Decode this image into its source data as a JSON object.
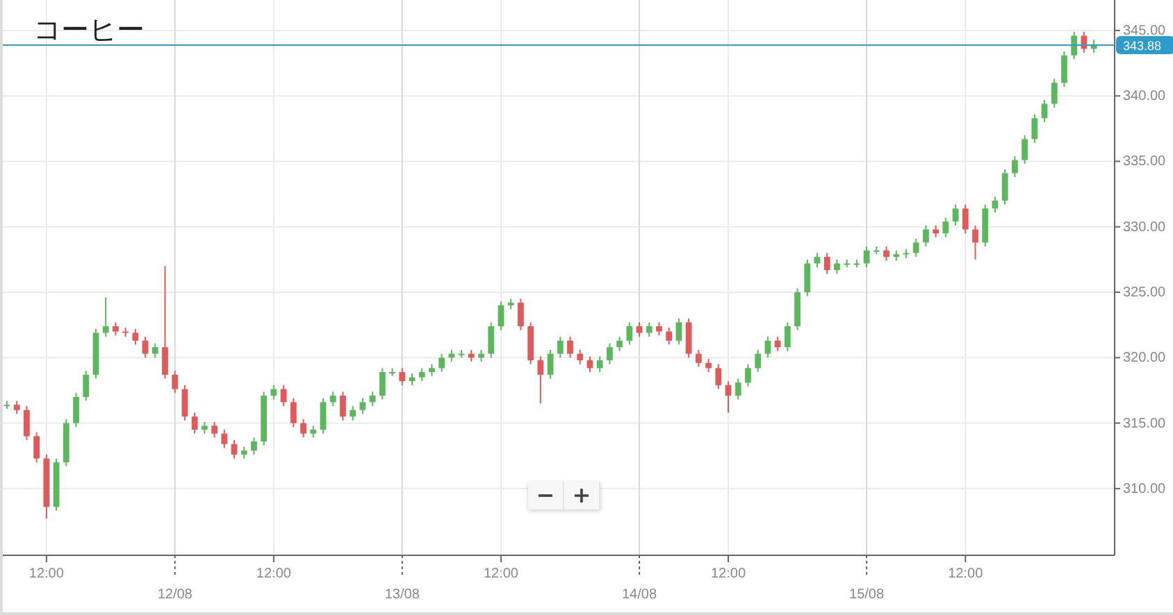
{
  "chart": {
    "chart_data": {
      "type": "candlestick",
      "title": "コーヒー",
      "grid": true,
      "ylim": [
        304.9,
        347.33
      ],
      "yticks": [
        {
          "value": 310,
          "label": "310.00"
        },
        {
          "value": 315,
          "label": "315.00"
        },
        {
          "value": 320,
          "label": "320.00"
        },
        {
          "value": 325,
          "label": "325.00"
        },
        {
          "value": 330,
          "label": "330.00"
        },
        {
          "value": 335,
          "label": "335.00"
        },
        {
          "value": 340,
          "label": "340.00"
        },
        {
          "value": 345,
          "label": "345.00"
        }
      ],
      "categories": [
        null,
        null,
        null,
        null,
        "12:00",
        null,
        null,
        null,
        null,
        null,
        null,
        null,
        null,
        null,
        null,
        null,
        null,
        "12/08",
        null,
        null,
        null,
        null,
        null,
        null,
        null,
        null,
        null,
        "12:00",
        null,
        null,
        null,
        null,
        null,
        null,
        null,
        null,
        null,
        null,
        null,
        null,
        "13/08",
        null,
        null,
        null,
        null,
        null,
        null,
        null,
        null,
        null,
        "12:00",
        null,
        null,
        null,
        null,
        null,
        null,
        null,
        null,
        null,
        null,
        null,
        null,
        null,
        "14/08",
        null,
        null,
        null,
        null,
        null,
        null,
        null,
        null,
        "12:00",
        null,
        null,
        null,
        null,
        null,
        null,
        null,
        null,
        null,
        null,
        null,
        null,
        null,
        "15/08",
        null,
        null,
        null,
        null,
        null,
        null,
        null,
        null,
        null,
        "12:00",
        null,
        null,
        null,
        null,
        null,
        null,
        null,
        null,
        null,
        null,
        null,
        null,
        null
      ],
      "ohlc": [
        [
          316.4,
          316.7,
          316.1,
          316.4
        ],
        [
          316.4,
          316.7,
          315.7,
          316.0
        ],
        [
          316.0,
          316.3,
          313.7,
          314.0
        ],
        [
          314.0,
          314.3,
          312.0,
          312.3
        ],
        [
          312.3,
          312.6,
          307.7,
          308.6
        ],
        [
          308.6,
          312.3,
          308.3,
          312.0
        ],
        [
          312.0,
          315.3,
          311.7,
          315.0
        ],
        [
          315.0,
          317.3,
          314.7,
          317.0
        ],
        [
          317.0,
          319.0,
          316.7,
          318.7
        ],
        [
          318.7,
          322.2,
          318.4,
          321.9
        ],
        [
          321.9,
          324.6,
          321.6,
          322.4
        ],
        [
          322.4,
          322.7,
          321.7,
          322.0
        ],
        [
          322.0,
          322.3,
          321.6,
          321.9
        ],
        [
          321.9,
          322.2,
          321.0,
          321.3
        ],
        [
          321.3,
          321.6,
          320.0,
          320.3
        ],
        [
          320.3,
          321.1,
          320.0,
          320.8
        ],
        [
          320.8,
          327.0,
          318.4,
          318.7
        ],
        [
          318.7,
          319.0,
          317.3,
          317.6
        ],
        [
          317.6,
          317.9,
          315.2,
          315.5
        ],
        [
          315.5,
          315.8,
          314.2,
          314.5
        ],
        [
          314.5,
          315.1,
          314.2,
          314.8
        ],
        [
          314.8,
          315.1,
          313.9,
          314.2
        ],
        [
          314.2,
          314.5,
          313.1,
          313.4
        ],
        [
          313.4,
          313.7,
          312.3,
          312.6
        ],
        [
          312.6,
          313.2,
          312.3,
          312.9
        ],
        [
          312.9,
          313.9,
          312.6,
          313.6
        ],
        [
          313.6,
          317.4,
          313.3,
          317.1
        ],
        [
          317.1,
          317.9,
          316.8,
          317.6
        ],
        [
          317.6,
          317.9,
          316.3,
          316.6
        ],
        [
          316.6,
          316.9,
          314.7,
          315.0
        ],
        [
          315.0,
          315.3,
          313.9,
          314.2
        ],
        [
          314.2,
          314.8,
          313.9,
          314.5
        ],
        [
          314.5,
          316.9,
          314.2,
          316.6
        ],
        [
          316.6,
          317.4,
          316.3,
          317.1
        ],
        [
          317.1,
          317.4,
          315.2,
          315.5
        ],
        [
          315.5,
          316.3,
          315.2,
          316.0
        ],
        [
          316.0,
          316.9,
          315.7,
          316.6
        ],
        [
          316.6,
          317.4,
          316.3,
          317.1
        ],
        [
          317.1,
          319.2,
          316.8,
          318.9
        ],
        [
          318.9,
          319.2,
          318.6,
          318.9
        ],
        [
          318.9,
          319.2,
          317.9,
          318.2
        ],
        [
          318.2,
          318.8,
          317.9,
          318.5
        ],
        [
          318.5,
          319.2,
          318.2,
          318.9
        ],
        [
          318.9,
          319.5,
          318.6,
          319.2
        ],
        [
          319.2,
          320.3,
          318.9,
          320.0
        ],
        [
          320.0,
          320.6,
          319.7,
          320.3
        ],
        [
          320.3,
          320.6,
          320.0,
          320.3
        ],
        [
          320.3,
          320.6,
          319.7,
          320.0
        ],
        [
          320.0,
          320.6,
          319.7,
          320.3
        ],
        [
          320.3,
          322.7,
          320.0,
          322.4
        ],
        [
          322.4,
          324.3,
          322.1,
          324.0
        ],
        [
          324.0,
          324.5,
          323.7,
          324.2
        ],
        [
          324.2,
          324.5,
          322.1,
          322.4
        ],
        [
          322.4,
          322.7,
          319.5,
          319.8
        ],
        [
          319.8,
          320.1,
          316.5,
          318.7
        ],
        [
          318.7,
          320.6,
          318.4,
          320.3
        ],
        [
          320.3,
          321.6,
          320.0,
          321.3
        ],
        [
          321.3,
          321.6,
          320.0,
          320.3
        ],
        [
          320.3,
          320.6,
          319.5,
          319.8
        ],
        [
          319.8,
          320.1,
          318.9,
          319.2
        ],
        [
          319.2,
          320.1,
          318.9,
          319.8
        ],
        [
          319.8,
          321.1,
          319.5,
          320.8
        ],
        [
          320.8,
          321.6,
          320.5,
          321.3
        ],
        [
          321.3,
          322.7,
          321.0,
          322.4
        ],
        [
          322.4,
          322.7,
          321.6,
          321.9
        ],
        [
          321.9,
          322.7,
          321.6,
          322.4
        ],
        [
          322.4,
          322.7,
          321.7,
          322.0
        ],
        [
          322.0,
          322.3,
          321.0,
          321.3
        ],
        [
          321.3,
          323.0,
          321.0,
          322.7
        ],
        [
          322.7,
          323.0,
          320.0,
          320.3
        ],
        [
          320.3,
          320.6,
          319.3,
          319.6
        ],
        [
          319.6,
          319.9,
          318.9,
          319.2
        ],
        [
          319.2,
          319.5,
          317.6,
          317.9
        ],
        [
          317.9,
          318.2,
          315.8,
          317.1
        ],
        [
          317.1,
          318.4,
          316.8,
          318.1
        ],
        [
          318.1,
          319.5,
          317.8,
          319.2
        ],
        [
          319.2,
          320.6,
          318.9,
          320.3
        ],
        [
          320.3,
          321.6,
          320.0,
          321.3
        ],
        [
          321.3,
          321.6,
          320.5,
          320.8
        ],
        [
          320.8,
          322.7,
          320.5,
          322.4
        ],
        [
          322.4,
          325.3,
          322.1,
          325.0
        ],
        [
          325.0,
          327.5,
          324.7,
          327.2
        ],
        [
          327.2,
          328.0,
          326.9,
          327.7
        ],
        [
          327.7,
          328.0,
          326.4,
          326.7
        ],
        [
          326.7,
          327.5,
          326.4,
          327.2
        ],
        [
          327.2,
          327.5,
          326.9,
          327.2
        ],
        [
          327.2,
          327.5,
          326.9,
          327.2
        ],
        [
          327.2,
          328.5,
          326.9,
          328.2
        ],
        [
          328.2,
          328.5,
          327.9,
          328.2
        ],
        [
          328.2,
          328.5,
          327.4,
          327.7
        ],
        [
          327.7,
          328.2,
          327.4,
          327.9
        ],
        [
          327.9,
          328.3,
          327.6,
          328.0
        ],
        [
          328.0,
          329.1,
          327.7,
          328.8
        ],
        [
          328.8,
          330.1,
          328.5,
          329.8
        ],
        [
          329.8,
          330.1,
          329.2,
          329.5
        ],
        [
          329.5,
          330.7,
          329.2,
          330.4
        ],
        [
          330.4,
          331.7,
          330.1,
          331.4
        ],
        [
          331.4,
          331.7,
          329.5,
          329.8
        ],
        [
          329.8,
          330.1,
          327.5,
          328.8
        ],
        [
          328.8,
          331.7,
          328.5,
          331.4
        ],
        [
          331.4,
          332.3,
          331.1,
          332.0
        ],
        [
          332.0,
          334.4,
          331.7,
          334.1
        ],
        [
          334.1,
          335.4,
          333.8,
          335.1
        ],
        [
          335.1,
          337.0,
          334.8,
          336.7
        ],
        [
          336.7,
          338.6,
          336.4,
          338.3
        ],
        [
          338.3,
          339.7,
          338.0,
          339.4
        ],
        [
          339.4,
          341.3,
          339.1,
          341.0
        ],
        [
          341.0,
          343.4,
          340.7,
          343.1
        ],
        [
          343.1,
          344.9,
          342.8,
          344.6
        ],
        [
          344.6,
          344.9,
          343.3,
          343.6
        ],
        [
          343.6,
          344.3,
          343.3,
          343.9
        ]
      ],
      "ref_lines": [
        {
          "axis": "y",
          "value": 343.88,
          "label": "343.88",
          "color": "#2e9cca"
        }
      ]
    }
  },
  "zoom": {
    "minus": "−",
    "plus": "+"
  }
}
